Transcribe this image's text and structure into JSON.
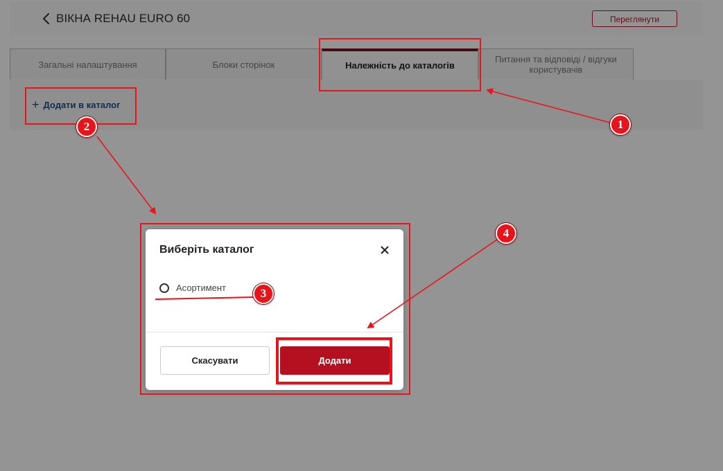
{
  "header": {
    "title": "ВІКНА REHAU EURO 60",
    "preview_label": "Переглянути"
  },
  "tabs": [
    {
      "label": "Загальні налаштування"
    },
    {
      "label": "Блоки сторінок"
    },
    {
      "label": "Належність до каталогів"
    },
    {
      "label": "Питання та відповіді / відгуки користувачів"
    }
  ],
  "panel": {
    "add_to_catalog_label": "Додати в каталог"
  },
  "modal": {
    "title": "Виберіть каталог",
    "options": [
      {
        "label": "Асортимент"
      }
    ],
    "cancel_label": "Скасувати",
    "add_label": "Додати"
  },
  "annotations": {
    "markers": [
      "1",
      "2",
      "3",
      "4"
    ],
    "color": "#e8141c"
  },
  "colors": {
    "accent": "#b4101f",
    "link": "#1f4e8a",
    "active_tab_bar": "#7b1020"
  }
}
